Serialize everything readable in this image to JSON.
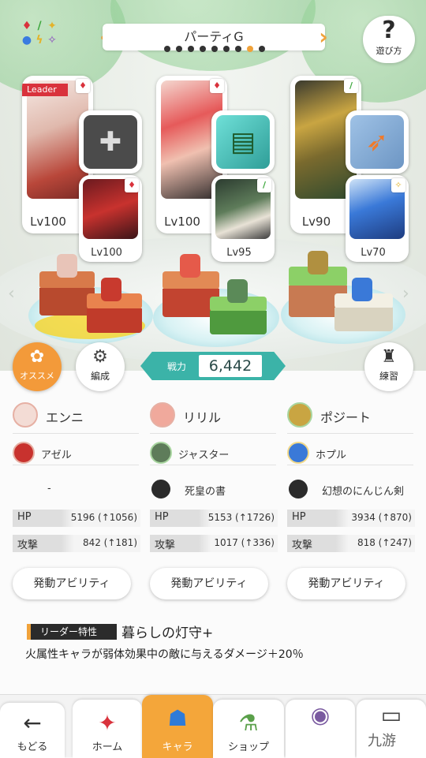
{
  "header": {
    "party_title": "パーティG",
    "help_label": "遊び方",
    "page_dots_count": 9,
    "active_dot_index": 7,
    "element_icons": [
      "♦",
      "/",
      "✦",
      "●",
      "ϟ",
      "✧"
    ]
  },
  "units": [
    {
      "level": "Lv100",
      "leader_tag": "Leader",
      "element": "♦",
      "element_color": "#d9323c",
      "sub_level": "Lv100",
      "sub_element": "♦",
      "sub_element_color": "#d9323c"
    },
    {
      "level": "Lv100",
      "element": "♦",
      "element_color": "#d9323c",
      "sub_level": "Lv95",
      "sub_element": "/",
      "sub_element_color": "#3aa63a"
    },
    {
      "level": "Lv90",
      "element": "/",
      "element_color": "#3aa63a",
      "sub_level": "Lv70",
      "sub_element": "✧",
      "sub_element_color": "#e3b32a"
    }
  ],
  "actions": {
    "recommend_label": "オススメ",
    "formation_label": "編成",
    "practice_label": "練習"
  },
  "power": {
    "label": "戦力",
    "value": "6,442"
  },
  "columns": [
    {
      "main_name": "エンニ",
      "sub_name": "アゼル",
      "equip_name": "-",
      "hp_label": "HP",
      "hp_value": "5196 (↑1056)",
      "atk_label": "攻撃",
      "atk_value": "842 (↑181)",
      "ability_label": "発動アビリティ"
    },
    {
      "main_name": "リリル",
      "sub_name": "ジャスター",
      "equip_name": "死皇の書",
      "hp_label": "HP",
      "hp_value": "5153 (↑1726)",
      "atk_label": "攻撃",
      "atk_value": "1017 (↑336)",
      "ability_label": "発動アビリティ"
    },
    {
      "main_name": "ポジート",
      "sub_name": "ホプル",
      "equip_name": "幻想のにんじん剣",
      "hp_label": "HP",
      "hp_value": "3934 (↑870)",
      "atk_label": "攻撃",
      "atk_value": "818 (↑247)",
      "ability_label": "発動アビリティ"
    }
  ],
  "leader_skill": {
    "tag": "リーダー特性",
    "name": "暮らしの灯守+",
    "description": "火属性キャラが弱体効果中の敵に与えるダメージ＋20％"
  },
  "nav": {
    "back": "もどる",
    "home": "ホーム",
    "chara": "キャラ",
    "shop": "ショップ"
  },
  "watermark": "九游",
  "colors": {
    "accent_orange": "#f0a23a",
    "power_teal": "#3bb3a8",
    "fire_red": "#d9323c",
    "wind_green": "#3aa63a",
    "nav_active": "#f4a63a"
  }
}
